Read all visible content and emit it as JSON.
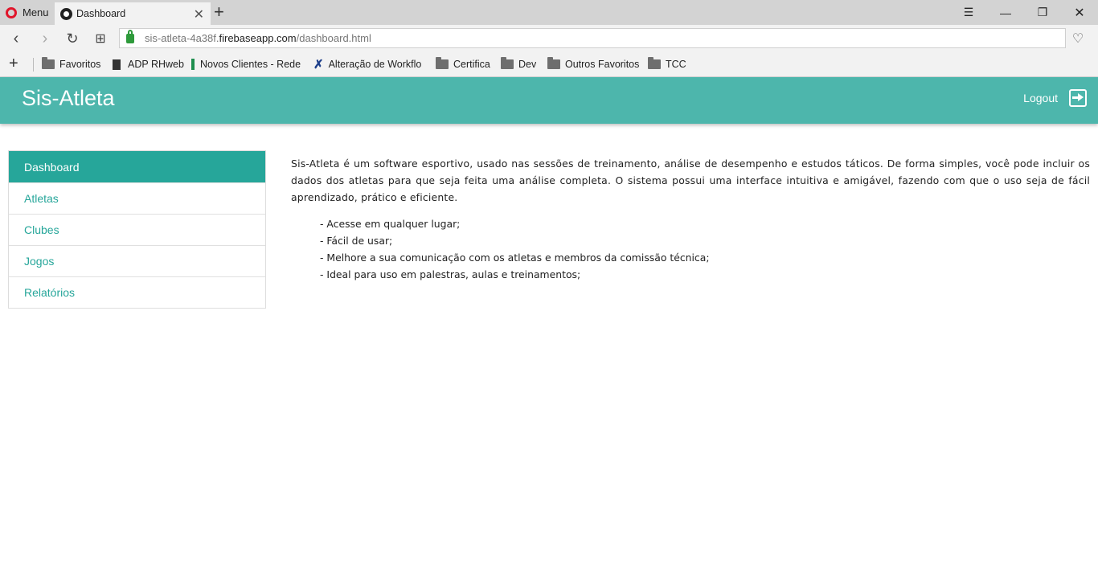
{
  "browser": {
    "menu_label": "Menu",
    "tab_title": "Dashboard",
    "url_prefix": "sis-atleta-4a38f.",
    "url_domain": "firebaseapp.com",
    "url_path": "/dashboard.html",
    "bookmarks": [
      {
        "label": "Favoritos",
        "icon": "folder-icon"
      },
      {
        "label": "ADP RHweb",
        "icon": "document-icon"
      },
      {
        "label": "Novos Clientes - Rede",
        "icon": "spreadsheet-icon"
      },
      {
        "label": "Alteração de Workflow",
        "icon": "tools-icon"
      },
      {
        "label": "Certifica",
        "icon": "folder-icon"
      },
      {
        "label": "Dev",
        "icon": "folder-icon"
      },
      {
        "label": "Outros Favoritos",
        "icon": "folder-icon"
      },
      {
        "label": "TCC",
        "icon": "folder-icon"
      }
    ]
  },
  "header": {
    "brand": "Sis-Atleta",
    "logout_label": "Logout"
  },
  "sidebar": {
    "items": [
      {
        "label": "Dashboard",
        "active": true
      },
      {
        "label": "Atletas"
      },
      {
        "label": "Clubes"
      },
      {
        "label": "Jogos"
      },
      {
        "label": "Relatórios"
      }
    ]
  },
  "main": {
    "intro": "Sis-Atleta é um software esportivo, usado nas sessões de treinamento, análise de desempenho e estudos táticos. De forma simples, você pode incluir os dados dos atletas para que seja feita uma análise completa. O sistema possui uma interface intuitiva e amigável, fazendo com que o uso seja de fácil aprendizado, prático e eficiente.",
    "bullets": [
      "- Acesse em qualquer lugar;",
      "- Fácil de usar;",
      "- Melhore a sua comunicação com os atletas e membros da comissão técnica;",
      "- Ideal para uso em palestras, aulas e treinamentos;"
    ]
  },
  "colors": {
    "header_bg": "#4db6ac",
    "active_item_bg": "#26a69a",
    "link_color": "#26a69a"
  }
}
